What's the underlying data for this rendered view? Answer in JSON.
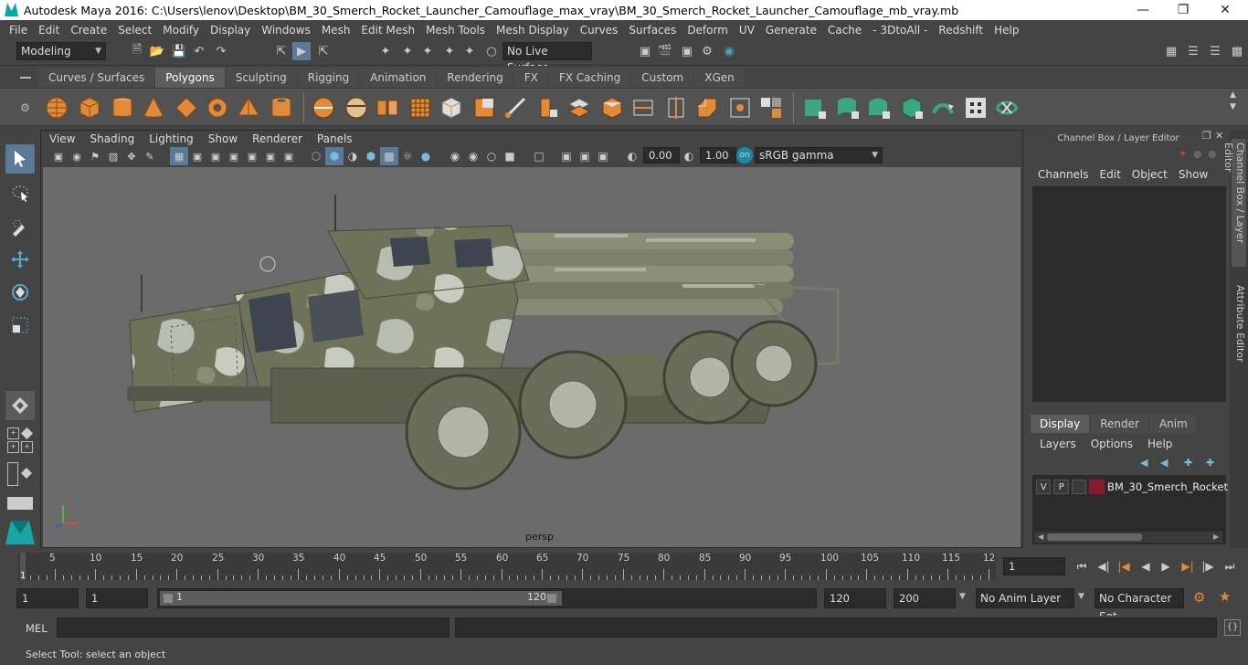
{
  "window": {
    "title": "Autodesk Maya 2016: C:\\Users\\lenov\\Desktop\\BM_30_Smerch_Rocket_Launcher_Camouflage_max_vray\\BM_30_Smerch_Rocket_Launcher_Camouflage_mb_vray.mb"
  },
  "menubar": [
    "File",
    "Edit",
    "Create",
    "Select",
    "Modify",
    "Display",
    "Windows",
    "Mesh",
    "Edit Mesh",
    "Mesh Tools",
    "Mesh Display",
    "Curves",
    "Surfaces",
    "Deform",
    "UV",
    "Generate",
    "Cache",
    "- 3DtoAll -",
    "Redshift",
    "Help"
  ],
  "statusline": {
    "mode": "Modeling",
    "live_surface": "No Live Surface"
  },
  "shelf_tabs": [
    "Curves / Surfaces",
    "Polygons",
    "Sculpting",
    "Rigging",
    "Animation",
    "Rendering",
    "FX",
    "FX Caching",
    "Custom",
    "XGen"
  ],
  "shelf_active": "Polygons",
  "viewport": {
    "menu": [
      "View",
      "Shading",
      "Lighting",
      "Show",
      "Renderer",
      "Panels"
    ],
    "exposure": "0.00",
    "gamma": "1.00",
    "color_space": "sRGB gamma",
    "camera": "persp"
  },
  "channel_box": {
    "header": "Channel Box / Layer Editor",
    "menu": [
      "Channels",
      "Edit",
      "Object",
      "Show"
    ],
    "display_tabs": [
      "Display",
      "Render",
      "Anim"
    ],
    "layer_menu": [
      "Layers",
      "Options",
      "Help"
    ],
    "layer": {
      "v": "V",
      "p": "P",
      "name": "BM_30_Smerch_Rocket",
      "color": "#8b1a2a"
    }
  },
  "side_tabs": [
    "Channel Box / Layer Editor",
    "Attribute Editor"
  ],
  "timeline": {
    "ticks": [
      "5",
      "10",
      "15",
      "20",
      "25",
      "30",
      "35",
      "40",
      "45",
      "50",
      "55",
      "60",
      "65",
      "70",
      "75",
      "80",
      "85",
      "90",
      "95",
      "100",
      "105",
      "110",
      "115",
      "12"
    ],
    "current_marker": "1",
    "current_frame": "1"
  },
  "range": {
    "start": "1",
    "playback_start": "1",
    "slider_start": "1",
    "slider_end": "120",
    "playback_end": "120",
    "end": "200",
    "anim_layer": "No Anim Layer",
    "character_set": "No Character Set"
  },
  "cmdline": {
    "label": "MEL"
  },
  "helpline": "Select Tool: select an object"
}
